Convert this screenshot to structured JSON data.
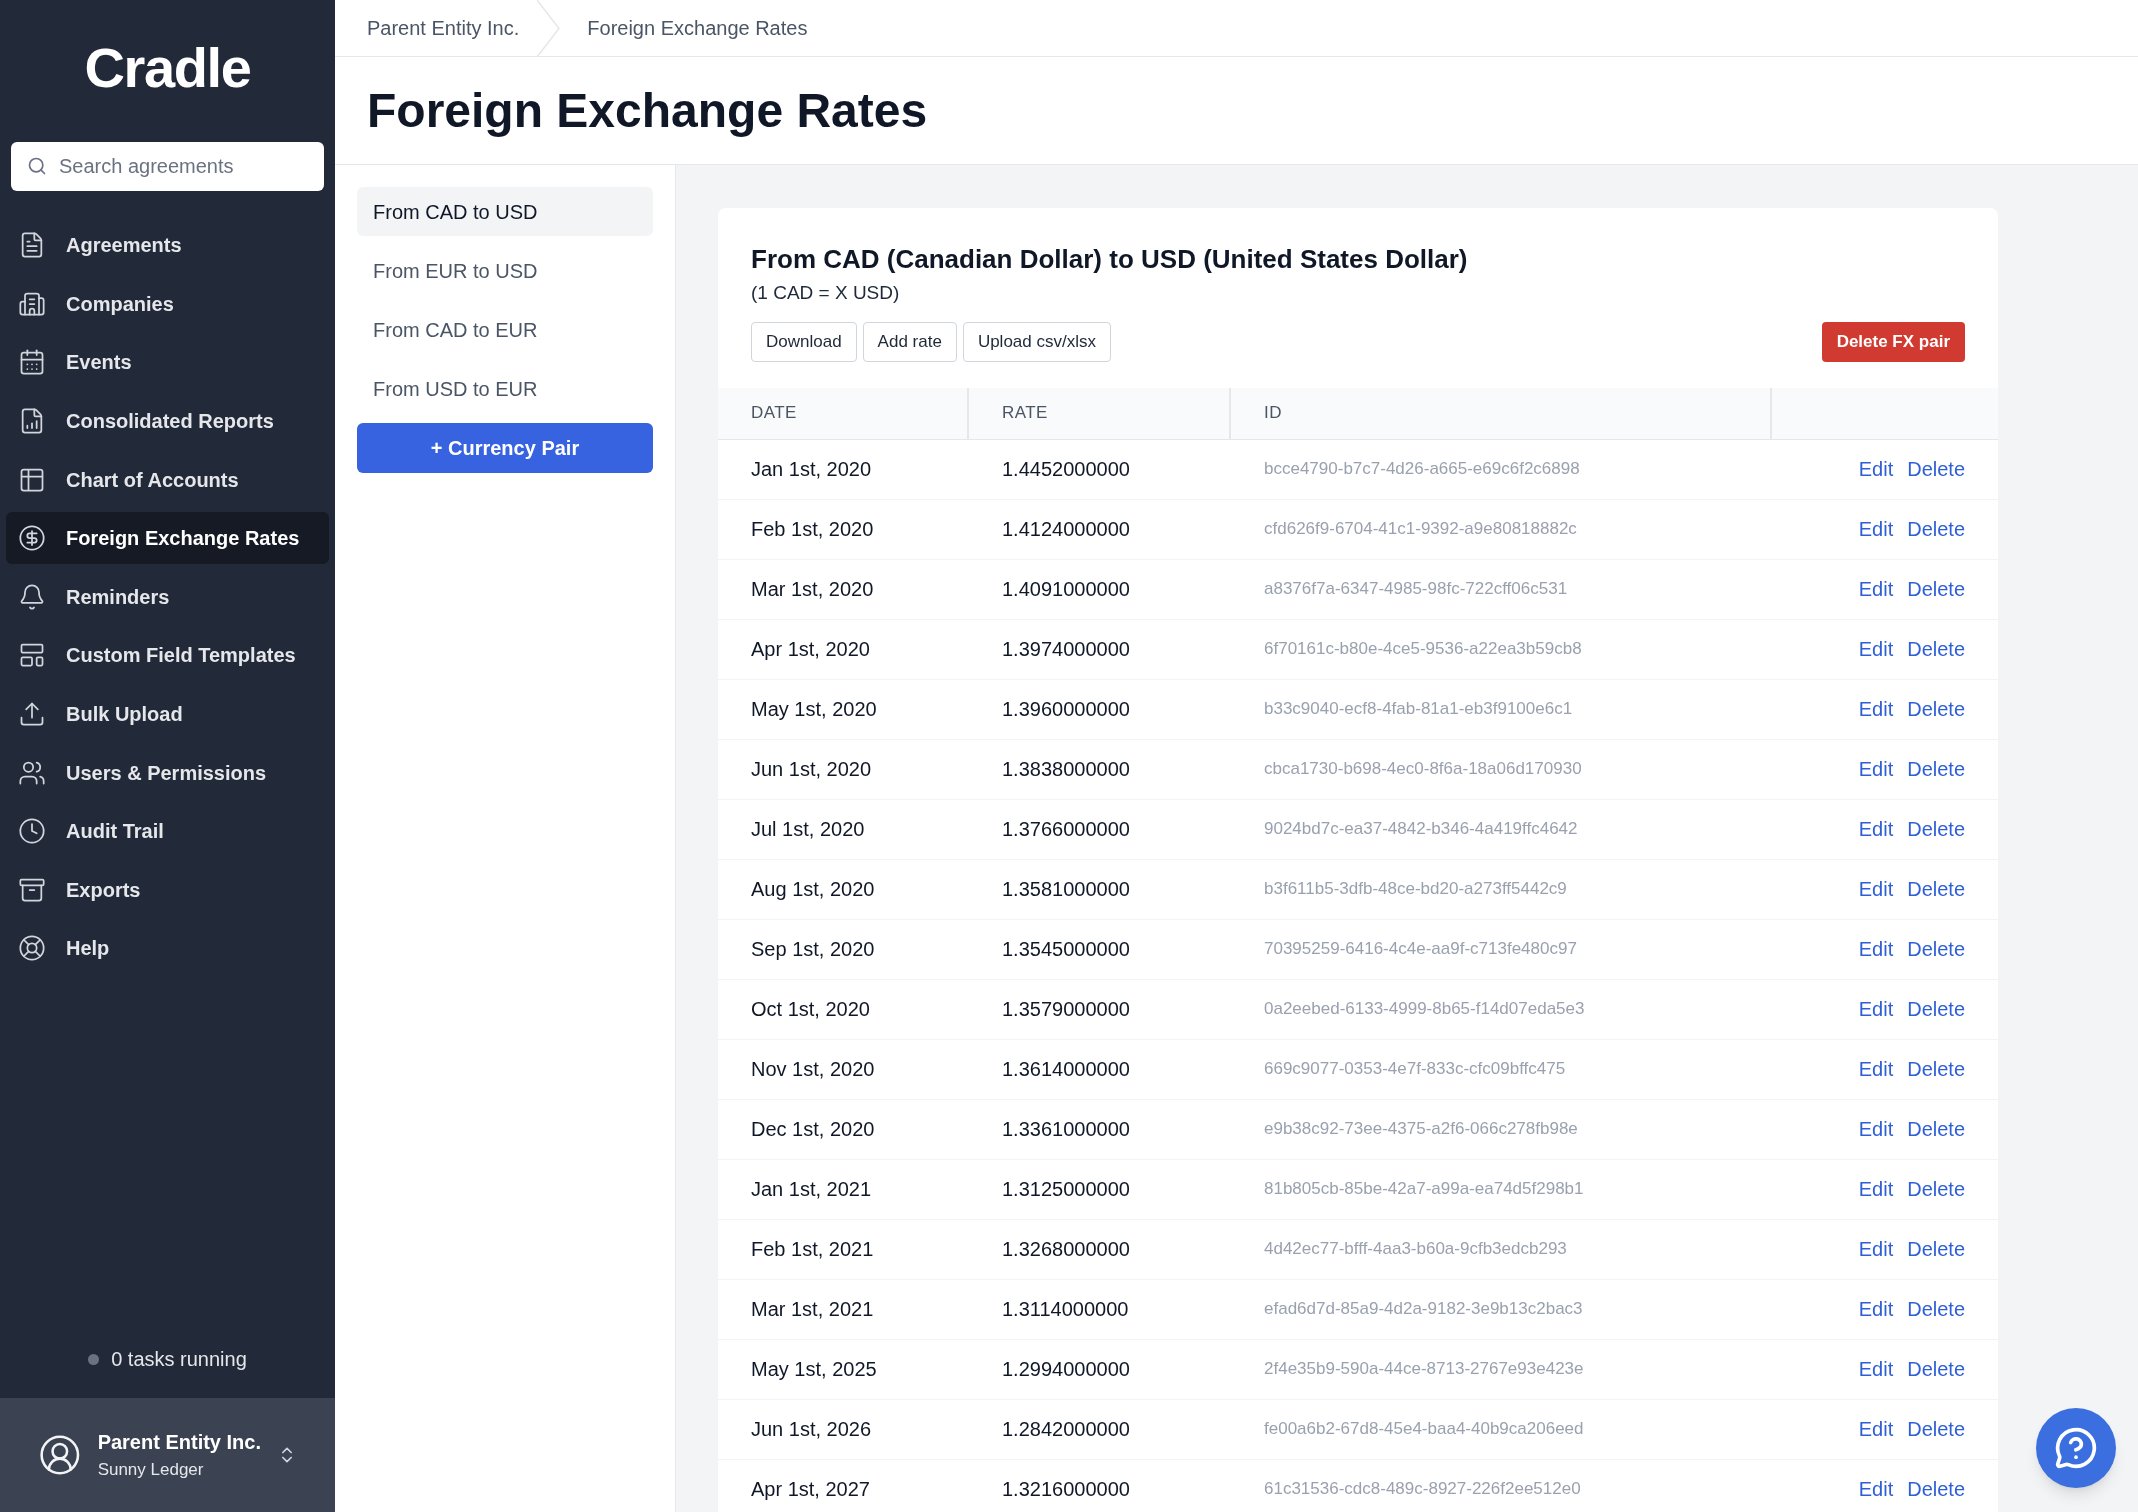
{
  "sidebar": {
    "logo": "Cradle",
    "search": {
      "placeholder": "Search agreements"
    },
    "items": [
      {
        "label": "Agreements",
        "selected": false
      },
      {
        "label": "Companies",
        "selected": false
      },
      {
        "label": "Events",
        "selected": false
      },
      {
        "label": "Consolidated Reports",
        "selected": false
      },
      {
        "label": "Chart of Accounts",
        "selected": false
      },
      {
        "label": "Foreign Exchange Rates",
        "selected": true
      },
      {
        "label": "Reminders",
        "selected": false
      },
      {
        "label": "Custom Field Templates",
        "selected": false
      },
      {
        "label": "Bulk Upload",
        "selected": false
      },
      {
        "label": "Users & Permissions",
        "selected": false
      },
      {
        "label": "Audit Trail",
        "selected": false
      },
      {
        "label": "Exports",
        "selected": false
      },
      {
        "label": "Help",
        "selected": false
      }
    ],
    "tasks": "0 tasks running",
    "account": {
      "name": "Parent Entity Inc.",
      "ledger": "Sunny Ledger"
    }
  },
  "breadcrumbs": [
    "Parent Entity Inc.",
    "Foreign Exchange Rates"
  ],
  "page_title": "Foreign Exchange Rates",
  "pairs": [
    {
      "label": "From CAD to USD",
      "selected": true
    },
    {
      "label": "From EUR to USD",
      "selected": false
    },
    {
      "label": "From CAD to EUR",
      "selected": false
    },
    {
      "label": "From USD to EUR",
      "selected": false
    }
  ],
  "add_pair_button": "+ Currency Pair",
  "card": {
    "title": "From CAD (Canadian Dollar) to USD (United States Dollar)",
    "subtitle": "(1 CAD = X USD)",
    "actions": [
      "Download",
      "Add rate",
      "Upload csv/xlsx"
    ],
    "delete_button": "Delete FX pair",
    "columns": [
      "DATE",
      "RATE",
      "ID"
    ],
    "rows": [
      {
        "date": "Jan 1st, 2020",
        "rate": "1.4452000000",
        "id": "bcce4790-b7c7-4d26-a665-e69c6f2c6898",
        "edit": "Edit",
        "delete": "Delete"
      },
      {
        "date": "Feb 1st, 2020",
        "rate": "1.4124000000",
        "id": "cfd626f9-6704-41c1-9392-a9e80818882c",
        "edit": "Edit",
        "delete": "Delete"
      },
      {
        "date": "Mar 1st, 2020",
        "rate": "1.4091000000",
        "id": "a8376f7a-6347-4985-98fc-722cff06c531",
        "edit": "Edit",
        "delete": "Delete"
      },
      {
        "date": "Apr 1st, 2020",
        "rate": "1.3974000000",
        "id": "6f70161c-b80e-4ce5-9536-a22ea3b59cb8",
        "edit": "Edit",
        "delete": "Delete"
      },
      {
        "date": "May 1st, 2020",
        "rate": "1.3960000000",
        "id": "b33c9040-ecf8-4fab-81a1-eb3f9100e6c1",
        "edit": "Edit",
        "delete": "Delete"
      },
      {
        "date": "Jun 1st, 2020",
        "rate": "1.3838000000",
        "id": "cbca1730-b698-4ec0-8f6a-18a06d170930",
        "edit": "Edit",
        "delete": "Delete"
      },
      {
        "date": "Jul 1st, 2020",
        "rate": "1.3766000000",
        "id": "9024bd7c-ea37-4842-b346-4a419ffc4642",
        "edit": "Edit",
        "delete": "Delete"
      },
      {
        "date": "Aug 1st, 2020",
        "rate": "1.3581000000",
        "id": "b3f611b5-3dfb-48ce-bd20-a273ff5442c9",
        "edit": "Edit",
        "delete": "Delete"
      },
      {
        "date": "Sep 1st, 2020",
        "rate": "1.3545000000",
        "id": "70395259-6416-4c4e-aa9f-c713fe480c97",
        "edit": "Edit",
        "delete": "Delete"
      },
      {
        "date": "Oct 1st, 2020",
        "rate": "1.3579000000",
        "id": "0a2eebed-6133-4999-8b65-f14d07eda5e3",
        "edit": "Edit",
        "delete": "Delete"
      },
      {
        "date": "Nov 1st, 2020",
        "rate": "1.3614000000",
        "id": "669c9077-0353-4e7f-833c-cfc09bffc475",
        "edit": "Edit",
        "delete": "Delete"
      },
      {
        "date": "Dec 1st, 2020",
        "rate": "1.3361000000",
        "id": "e9b38c92-73ee-4375-a2f6-066c278fb98e",
        "edit": "Edit",
        "delete": "Delete"
      },
      {
        "date": "Jan 1st, 2021",
        "rate": "1.3125000000",
        "id": "81b805cb-85be-42a7-a99a-ea74d5f298b1",
        "edit": "Edit",
        "delete": "Delete"
      },
      {
        "date": "Feb 1st, 2021",
        "rate": "1.3268000000",
        "id": "4d42ec77-bfff-4aa3-b60a-9cfb3edcb293",
        "edit": "Edit",
        "delete": "Delete"
      },
      {
        "date": "Mar 1st, 2021",
        "rate": "1.3114000000",
        "id": "efad6d7d-85a9-4d2a-9182-3e9b13c2bac3",
        "edit": "Edit",
        "delete": "Delete"
      },
      {
        "date": "May 1st, 2025",
        "rate": "1.2994000000",
        "id": "2f4e35b9-590a-44ce-8713-2767e93e423e",
        "edit": "Edit",
        "delete": "Delete"
      },
      {
        "date": "Jun 1st, 2026",
        "rate": "1.2842000000",
        "id": "fe00a6b2-67d8-45e4-baa4-40b9ca206eed",
        "edit": "Edit",
        "delete": "Delete"
      },
      {
        "date": "Apr 1st, 2027",
        "rate": "1.3216000000",
        "id": "61c31536-cdc8-489c-8927-226f2ee512e0",
        "edit": "Edit",
        "delete": "Delete"
      }
    ]
  }
}
